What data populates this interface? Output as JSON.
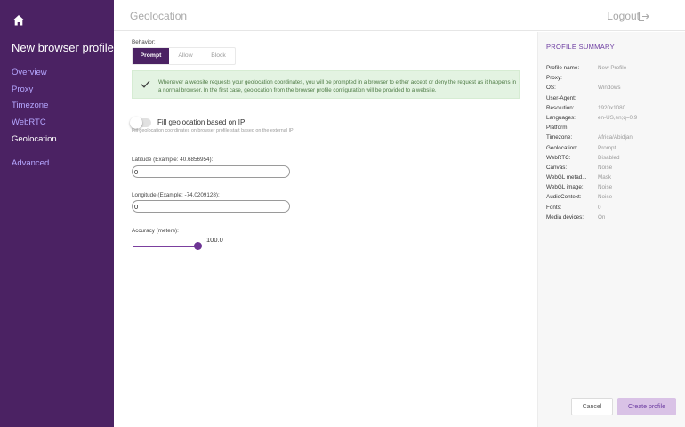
{
  "sidebar": {
    "title": "New browser profile",
    "items": [
      {
        "label": "Overview"
      },
      {
        "label": "Proxy"
      },
      {
        "label": "Timezone"
      },
      {
        "label": "WebRTC"
      },
      {
        "label": "Geolocation"
      }
    ],
    "advanced": "Advanced",
    "home_icon": "home-icon"
  },
  "header": {
    "title": "Geolocation",
    "logout": "Logout",
    "logout_icon": "logout-icon"
  },
  "behavior": {
    "label": "Behavior:",
    "options": [
      "Prompt",
      "Allow",
      "Block"
    ],
    "selected": "Prompt",
    "alert": "Whenever a website requests your geolocation coordinates, you will be prompted in a browser to either accept or deny the request as it happens in a normal browser. In the first case, geolocation from the browser profile configuration will be provided to a website."
  },
  "fill_by_ip": {
    "label": "Fill geolocation based on IP",
    "help": "Fill geolocation coordinates on browser profile start based on the external IP",
    "enabled": false
  },
  "latitude": {
    "label": "Latitude (Example: 40.6856954):",
    "value": "0"
  },
  "longitude": {
    "label": "Longitude (Example: -74.0209128):",
    "value": "0"
  },
  "accuracy": {
    "label": "Accuracy (meters):",
    "value": "100.0",
    "fraction": 1.0
  },
  "summary": {
    "title": "PROFILE SUMMARY",
    "rows": [
      {
        "key": "Profile name:",
        "value": "New Profile"
      },
      {
        "key": "Proxy:",
        "value": ""
      },
      {
        "key": "OS:",
        "value": "Windows"
      },
      {
        "key": "User-Agent:",
        "value": ""
      },
      {
        "key": "Resolution:",
        "value": "1920x1080"
      },
      {
        "key": "Languages:",
        "value": "en-US,en;q=0.9"
      },
      {
        "key": "Platform:",
        "value": ""
      },
      {
        "key": "Timezone:",
        "value": "Africa/Abidjan"
      },
      {
        "key": "Geolocation:",
        "value": "Prompt"
      },
      {
        "key": "WebRTC:",
        "value": "Disabled"
      },
      {
        "key": "Canvas:",
        "value": "Noise"
      },
      {
        "key": "WebGL metad...",
        "value": "Mask"
      },
      {
        "key": "WebGL image:",
        "value": "Noise"
      },
      {
        "key": "AudioContext:",
        "value": "Noise"
      },
      {
        "key": "Fonts:",
        "value": "0"
      },
      {
        "key": "Media devices:",
        "value": "On"
      }
    ],
    "cancel": "Cancel",
    "create": "Create profile"
  },
  "colors": {
    "sidebar_bg": "#4b2263",
    "accent": "#6b3aa0",
    "nav_link": "#b5a7ff",
    "alert_bg": "#e3f3e2"
  }
}
